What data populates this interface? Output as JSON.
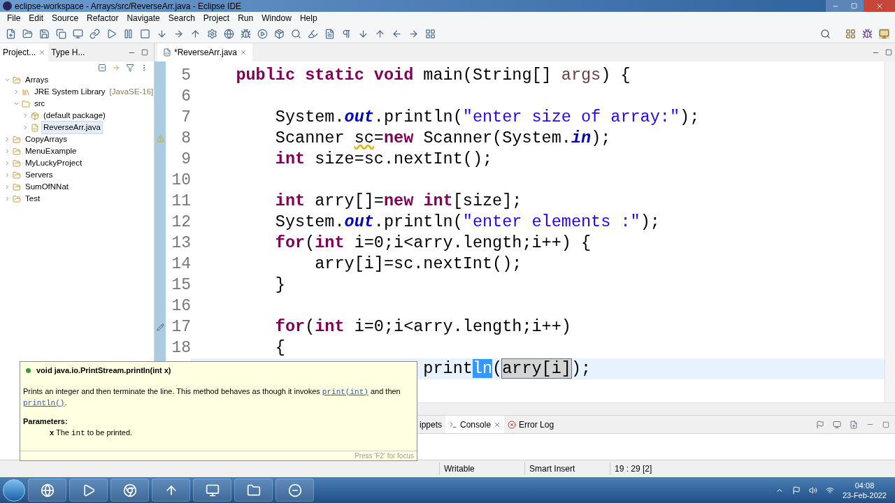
{
  "window": {
    "title": "eclipse-workspace - Arrays/src/ReverseArr.java - Eclipse IDE"
  },
  "menu": [
    "File",
    "Edit",
    "Source",
    "Refactor",
    "Navigate",
    "Search",
    "Project",
    "Run",
    "Window",
    "Help"
  ],
  "left_panel": {
    "tabs": [
      {
        "label": "Project...",
        "selected": true,
        "closable": true
      },
      {
        "label": "Type H...",
        "selected": false,
        "closable": false
      }
    ],
    "tree": [
      {
        "label": "Arrays",
        "kind": "project",
        "expanded": true,
        "selected": false,
        "children": [
          {
            "label": "JRE System Library",
            "decoration": "[JavaSE-16]",
            "kind": "library",
            "expanded": false,
            "selected": false
          },
          {
            "label": "src",
            "kind": "folder",
            "expanded": true,
            "selected": false,
            "children": [
              {
                "label": "(default package)",
                "kind": "package",
                "expanded": false,
                "selected": false
              },
              {
                "label": "ReverseArr.java",
                "kind": "file",
                "expanded": false,
                "selected": true
              }
            ]
          }
        ]
      },
      {
        "label": "CopyArrays",
        "kind": "project",
        "expanded": false,
        "selected": false
      },
      {
        "label": "MenuExample",
        "kind": "project",
        "expanded": false,
        "selected": false
      },
      {
        "label": "MyLuckyProject",
        "kind": "project",
        "expanded": false,
        "selected": false
      },
      {
        "label": "Servers",
        "kind": "project",
        "expanded": false,
        "selected": false
      },
      {
        "label": "SumOfNNat",
        "kind": "project",
        "expanded": false,
        "selected": false
      },
      {
        "label": "Test",
        "kind": "project",
        "expanded": false,
        "selected": false
      }
    ]
  },
  "editor": {
    "tabs": [
      {
        "label": "*ReverseArr.java",
        "selected": true
      }
    ],
    "lines": [
      {
        "number": "5",
        "current": false,
        "warning": false,
        "edited": false,
        "tokens": [
          {
            "kind": "kw",
            "text": "    public static void"
          },
          {
            "kind": "plain",
            "text": " main(String[] "
          },
          {
            "kind": "param",
            "text": "args"
          },
          {
            "kind": "plain",
            "text": ") {"
          }
        ]
      },
      {
        "number": "6",
        "current": false,
        "warning": false,
        "edited": false
      },
      {
        "number": "7",
        "current": false,
        "warning": false,
        "edited": false,
        "tokens": [
          {
            "kind": "plain",
            "text": "        System."
          },
          {
            "kind": "field",
            "text": "out"
          },
          {
            "kind": "plain",
            "text": ".println("
          },
          {
            "kind": "str",
            "text": "\"enter size of array:\""
          },
          {
            "kind": "plain",
            "text": ");"
          }
        ]
      },
      {
        "number": "8",
        "current": false,
        "warning": true,
        "edited": false,
        "tokens": [
          {
            "kind": "plain",
            "text": "        Scanner "
          },
          {
            "kind": "warn",
            "text": "sc"
          },
          {
            "kind": "plain",
            "text": "="
          },
          {
            "kind": "kw",
            "text": "new"
          },
          {
            "kind": "plain",
            "text": " Scanner(System."
          },
          {
            "kind": "field",
            "text": "in"
          },
          {
            "kind": "plain",
            "text": ");"
          }
        ]
      },
      {
        "number": "9",
        "current": false,
        "warning": false,
        "edited": false,
        "tokens": [
          {
            "kind": "kw",
            "text": "        int"
          },
          {
            "kind": "plain",
            "text": " size=sc.nextInt();"
          }
        ]
      },
      {
        "number": "10",
        "current": false,
        "warning": false,
        "edited": false
      },
      {
        "number": "11",
        "current": false,
        "warning": false,
        "edited": false,
        "tokens": [
          {
            "kind": "kw",
            "text": "        int"
          },
          {
            "kind": "plain",
            "text": " arry[]="
          },
          {
            "kind": "kw",
            "text": "new int"
          },
          {
            "kind": "plain",
            "text": "[size];"
          }
        ]
      },
      {
        "number": "12",
        "current": false,
        "warning": false,
        "edited": false,
        "tokens": [
          {
            "kind": "plain",
            "text": "        System."
          },
          {
            "kind": "field",
            "text": "out"
          },
          {
            "kind": "plain",
            "text": ".println("
          },
          {
            "kind": "str",
            "text": "\"enter elements :\""
          },
          {
            "kind": "plain",
            "text": ");"
          }
        ]
      },
      {
        "number": "13",
        "current": false,
        "warning": false,
        "edited": false,
        "tokens": [
          {
            "kind": "kw",
            "text": "        for"
          },
          {
            "kind": "plain",
            "text": "("
          },
          {
            "kind": "kw",
            "text": "int"
          },
          {
            "kind": "plain",
            "text": " i=0;i<arry.length;i++) {"
          }
        ]
      },
      {
        "number": "14",
        "current": false,
        "warning": false,
        "edited": false,
        "tokens": [
          {
            "kind": "plain",
            "text": "            arry[i]=sc.nextInt();"
          }
        ]
      },
      {
        "number": "15",
        "current": false,
        "warning": false,
        "edited": false,
        "tokens": [
          {
            "kind": "plain",
            "text": "        }"
          }
        ]
      },
      {
        "number": "16",
        "current": false,
        "warning": false,
        "edited": false
      },
      {
        "number": "17",
        "current": false,
        "warning": false,
        "edited": true,
        "tokens": [
          {
            "kind": "kw",
            "text": "        for"
          },
          {
            "kind": "plain",
            "text": "("
          },
          {
            "kind": "kw",
            "text": "int"
          },
          {
            "kind": "plain",
            "text": " i=0;i<arry.length;i++)"
          }
        ]
      },
      {
        "number": "18",
        "current": false,
        "warning": false,
        "edited": false,
        "tokens": [
          {
            "kind": "plain",
            "text": "        {"
          }
        ]
      },
      {
        "current": true,
        "warning": false,
        "edited": false,
        "tokens": [
          {
            "kind": "plain",
            "text": "                       print"
          },
          {
            "kind": "sel",
            "text": "ln"
          },
          {
            "kind": "plain",
            "text": "("
          },
          {
            "kind": "occ",
            "text": "arry[i]"
          },
          {
            "kind": "plain",
            "text": ");"
          }
        ]
      }
    ]
  },
  "tooltip": {
    "signature": "void java.io.PrintStream.println(int x)",
    "description": [
      {
        "kind": "text",
        "text": "Prints an integer and then terminate the line. This method behaves as though it invokes "
      },
      {
        "kind": "link",
        "text": "print(int)"
      },
      {
        "kind": "text",
        "text": " and then "
      },
      {
        "kind": "link",
        "text": "println()"
      },
      {
        "kind": "text",
        "text": "."
      }
    ],
    "parameters_label": "Parameters:",
    "parameter": [
      {
        "kind": "bold",
        "text": "x"
      },
      {
        "kind": "text",
        "text": " The "
      },
      {
        "kind": "code",
        "text": "int"
      },
      {
        "kind": "text",
        "text": " to be printed."
      }
    ],
    "hint": "Press 'F2' for focus"
  },
  "bottom_panel": {
    "tabs": [
      {
        "label": "ippets",
        "kind": "snippets",
        "selected": false,
        "closable": false
      },
      {
        "label": "Console",
        "kind": "console",
        "selected": true,
        "closable": true
      },
      {
        "label": "Error Log",
        "kind": "errorlog",
        "selected": false,
        "closable": false
      }
    ]
  },
  "status_bar": [
    "Writable",
    "Smart Insert",
    "19 : 29 [2]"
  ],
  "taskbar": {
    "time": "04:08",
    "date": "23-Feb-2022"
  }
}
